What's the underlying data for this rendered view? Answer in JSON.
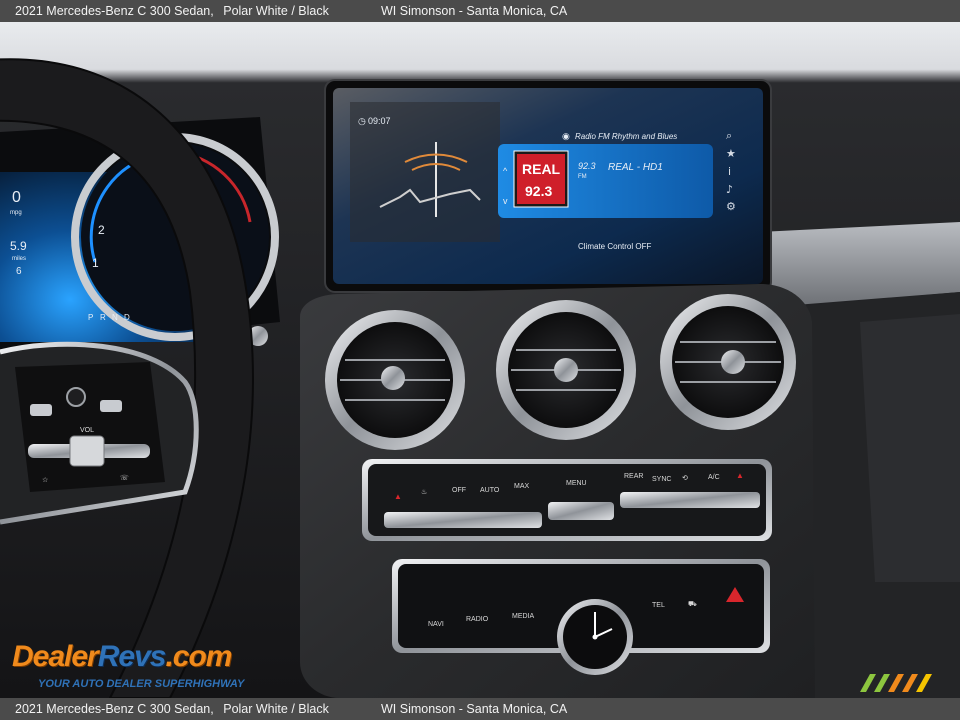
{
  "caption": {
    "vehicle": "2021 Mercedes-Benz C 300 Sedan,",
    "color": "Polar White / Black",
    "dealer": "WI Simonson - Santa Monica, CA"
  },
  "screen": {
    "time": "09:07",
    "radio_source": "Radio FM Rhythm and Blues",
    "station_freq": "92.3",
    "band": "FM",
    "station_name": "REAL - HD1",
    "logo_line1": "REAL",
    "logo_line2": "92.3",
    "status": "Climate Control OFF"
  },
  "cluster": {
    "range_top": "0",
    "range_top_unit": "mpg",
    "trip": "5.9",
    "trip_unit": "miles",
    "gauge_labels": [
      "2",
      "1",
      "6"
    ],
    "left_small": "6",
    "gears": [
      "P",
      "R",
      "N",
      "D"
    ]
  },
  "wheel": {
    "vol_label": "VOL"
  },
  "climate_buttons": {
    "auto": "AUTO",
    "max": "MAX",
    "off": "OFF",
    "menu": "MENU",
    "sync": "SYNC",
    "ac": "A/C",
    "rear": "REAR"
  },
  "lower_panel": {
    "navi": "NAVI",
    "radio": "RADIO",
    "media": "MEDIA",
    "tel": "TEL"
  },
  "watermark": {
    "brand_a": "Dealer",
    "brand_b": "Revs",
    "brand_c": ".com",
    "tagline": "YOUR AUTO DEALER SUPERHIGHWAY"
  },
  "colors": {
    "screen_blue": "#1e7fd6",
    "hazard_red": "#d8262c",
    "watermark_orange": "#f08a1c",
    "watermark_blue": "#2f72b8"
  }
}
